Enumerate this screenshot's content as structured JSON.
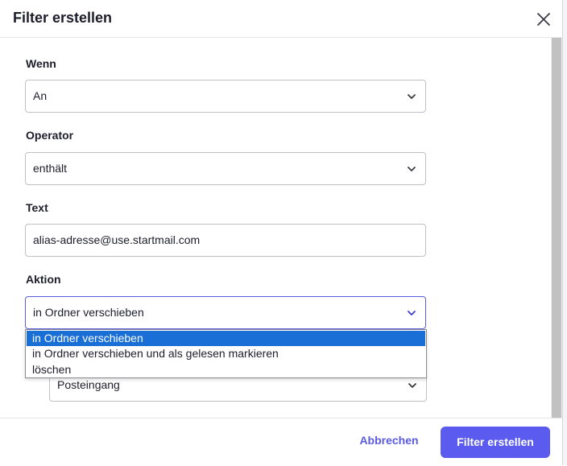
{
  "dialog": {
    "title": "Filter erstellen",
    "close_icon": "close-icon"
  },
  "form": {
    "wenn": {
      "label": "Wenn",
      "value": "An"
    },
    "operator": {
      "label": "Operator",
      "value": "enthält"
    },
    "text": {
      "label": "Text",
      "value": "alias-adresse@use.startmail.com"
    },
    "aktion": {
      "label": "Aktion",
      "value": "in Ordner verschieben",
      "options": [
        "in Ordner verschieben",
        "in Ordner verschieben und als gelesen markieren",
        "löschen"
      ],
      "selected_index": 0
    },
    "folder": {
      "value": "Posteingang"
    }
  },
  "footer": {
    "cancel_label": "Abbrechen",
    "submit_label": "Filter erstellen"
  },
  "colors": {
    "accent": "#5b5bf0",
    "accent_text": "#5b5bdf",
    "option_selected": "#1a6fd6",
    "text": "#1d1d2b"
  }
}
